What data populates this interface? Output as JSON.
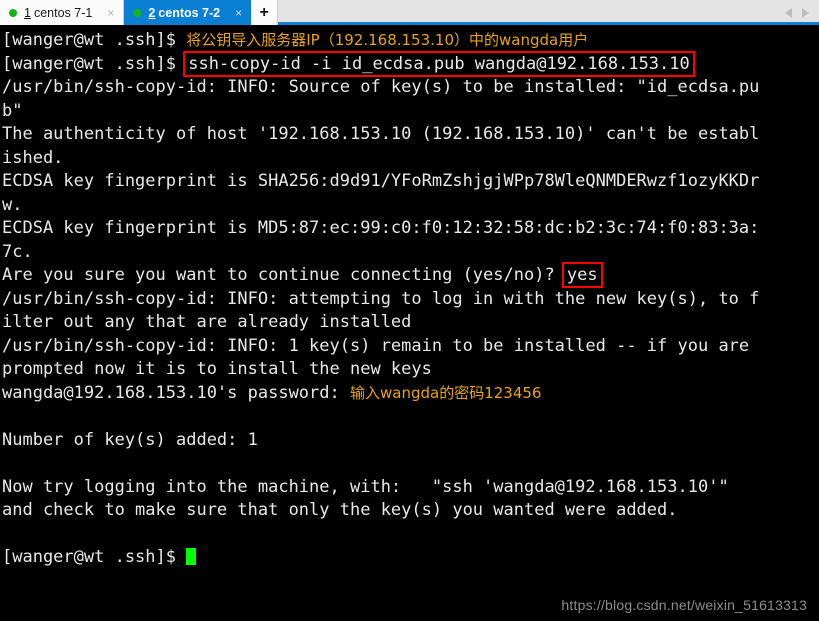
{
  "tabbar": {
    "tabs": [
      {
        "number": "1",
        "label": "centos 7-1",
        "close": "×",
        "status_color": "#17b317",
        "active": false
      },
      {
        "number": "2",
        "label": "centos 7-2",
        "close": "×",
        "status_color": "#0b7fd4",
        "active": true
      }
    ],
    "new_tab_label": "+",
    "active_tab_bg": "#0b7fd4"
  },
  "terminal": {
    "prompt": "[wanger@wt .ssh]$ ",
    "lines": [
      {
        "id": "line-prompt-annotated",
        "text": "[wanger@wt .ssh]$ ",
        "annotation": "将公钥导入服务器IP（192.168.153.10）中的wangda用户"
      },
      {
        "id": "line-command",
        "text": "[wanger@wt .ssh]$ ",
        "boxed": "ssh-copy-id -i id_ecdsa.pub wangda@192.168.153.10"
      },
      {
        "id": "line-info-source-1",
        "text": "/usr/bin/ssh-copy-id: INFO: Source of key(s) to be installed: \"id_ecdsa.pu"
      },
      {
        "id": "line-info-source-2",
        "text": "b\""
      },
      {
        "id": "line-authenticity-1",
        "text": "The authenticity of host '192.168.153.10 (192.168.153.10)' can't be establ"
      },
      {
        "id": "line-authenticity-2",
        "text": "ished."
      },
      {
        "id": "line-sha256-1",
        "text": "ECDSA key fingerprint is SHA256:d9d91/YFoRmZshjgjWPp78WleQNMDERwzf1ozyKKDr"
      },
      {
        "id": "line-sha256-2",
        "text": "w."
      },
      {
        "id": "line-md5-1",
        "text": "ECDSA key fingerprint is MD5:87:ec:99:c0:f0:12:32:58:dc:b2:3c:74:f0:83:3a:"
      },
      {
        "id": "line-md5-2",
        "text": "7c."
      },
      {
        "id": "line-continue-prompt",
        "text": "Are you sure you want to continue connecting (yes/no)? ",
        "boxed": "yes"
      },
      {
        "id": "line-info-attempt-1",
        "text": "/usr/bin/ssh-copy-id: INFO: attempting to log in with the new key(s), to f"
      },
      {
        "id": "line-info-attempt-2",
        "text": "ilter out any that are already installed"
      },
      {
        "id": "line-info-remain-1",
        "text": "/usr/bin/ssh-copy-id: INFO: 1 key(s) remain to be installed -- if you are"
      },
      {
        "id": "line-info-remain-2",
        "text": "prompted now it is to install the new keys"
      },
      {
        "id": "line-password-prompt",
        "text": "wangda@192.168.153.10's password: ",
        "annotation": "输入wangda的密码123456"
      },
      {
        "id": "line-blank-1",
        "text": ""
      },
      {
        "id": "line-keys-added",
        "text": "Number of key(s) added: 1"
      },
      {
        "id": "line-blank-2",
        "text": ""
      },
      {
        "id": "line-now-try",
        "text": "Now try logging into the machine, with:   \"ssh 'wangda@192.168.153.10'\""
      },
      {
        "id": "line-and-check",
        "text": "and check to make sure that only the key(s) you wanted were added."
      },
      {
        "id": "line-blank-3",
        "text": ""
      },
      {
        "id": "line-final-prompt",
        "text": "[wanger@wt .ssh]$ ",
        "cursor": true
      }
    ],
    "colors": {
      "background": "#000000",
      "foreground": "#e8e8e8",
      "annotation": "#e8a317",
      "highlight_box": "#ff0000",
      "cursor": "#00ff00"
    }
  },
  "watermark": {
    "text": "https://blog.csdn.net/weixin_51613313"
  }
}
